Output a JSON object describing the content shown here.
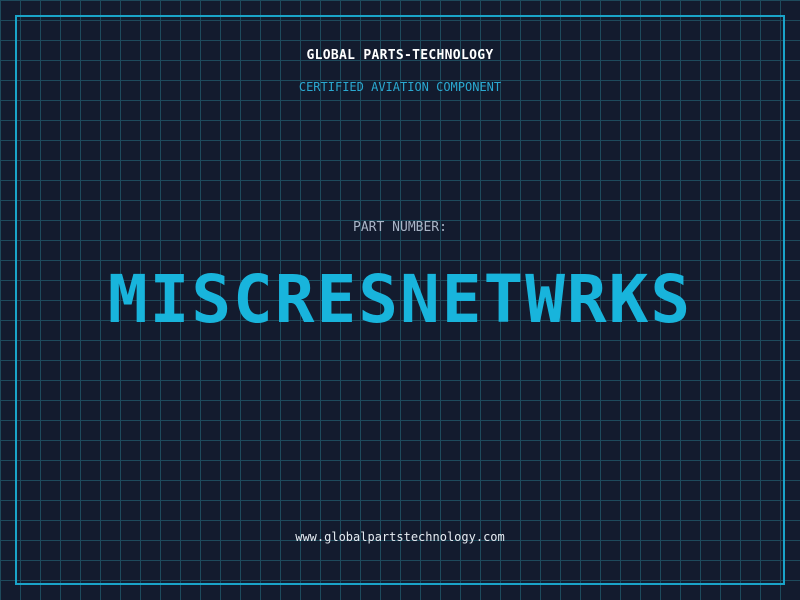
{
  "header": {
    "company": "GLOBAL PARTS-TECHNOLOGY",
    "tagline": "CERTIFIED AVIATION COMPONENT"
  },
  "part": {
    "label": "PART NUMBER:",
    "number": "MISCRESNETWRKS"
  },
  "footer": {
    "website": "www.globalpartstechnology.com"
  },
  "colors": {
    "background": "#131b2e",
    "grid": "#1e4a5c",
    "accent": "#1aa3c8",
    "part_number": "#18b4dc",
    "label": "#a9b4c6",
    "text": "#ffffff"
  }
}
